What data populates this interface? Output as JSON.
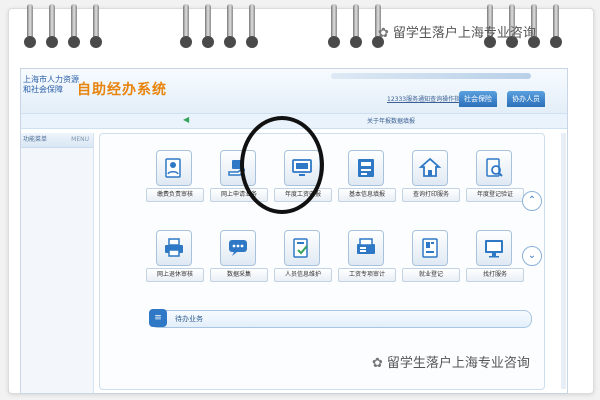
{
  "watermark": {
    "top": "留学生落户上海专业咨询",
    "bottom": "留学生落户上海专业咨询",
    "icon": "wechat-icon"
  },
  "header": {
    "logo_line1": "上海市人力资源",
    "logo_line2": "和社会保障",
    "system_title": "自助经办系统",
    "link_text": "12333服务通知查询操作指南",
    "tabs": [
      {
        "label": "社会保险"
      },
      {
        "label": "协办人员"
      }
    ]
  },
  "subbar": {
    "text": "关于年报数据填报"
  },
  "sidebar": {
    "title": "功能菜单",
    "menu_label": "MENU"
  },
  "services_row1": [
    {
      "label": "缴费负责审核",
      "icon": "person-document-icon"
    },
    {
      "label": "网上申请业务",
      "icon": "hand-card-icon"
    },
    {
      "label": "年度工资申报",
      "icon": "monitor-icon"
    },
    {
      "label": "基本信息填报",
      "icon": "id-card-icon"
    },
    {
      "label": "查询打印服务",
      "icon": "house-icon"
    },
    {
      "label": "年度登记验证",
      "icon": "document-search-icon"
    }
  ],
  "services_row2": [
    {
      "label": "网上退休审核",
      "icon": "printer-icon"
    },
    {
      "label": "数据采集",
      "icon": "chat-bubble-icon"
    },
    {
      "label": "人员信息维护",
      "icon": "edit-document-icon"
    },
    {
      "label": "工资专项审计",
      "icon": "fax-icon"
    },
    {
      "label": "就业登记",
      "icon": "phone-card-icon"
    },
    {
      "label": "找打服务",
      "icon": "screen-icon"
    }
  ],
  "todo": {
    "label": "待办业务"
  },
  "colors": {
    "accent": "#2f78c5",
    "title_orange": "#e8830c",
    "highlight_circle": "#111111"
  }
}
